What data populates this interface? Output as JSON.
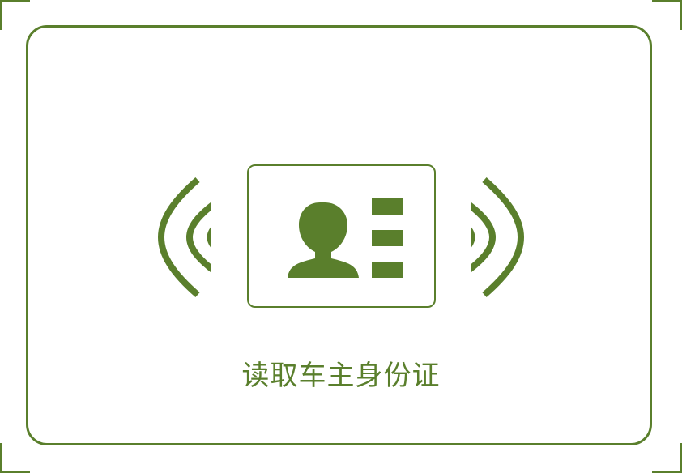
{
  "colors": {
    "accent": "#5a7f2c",
    "background": "#ffffff"
  },
  "icons": {
    "card": "id-card-icon",
    "person": "person-icon",
    "wave_left": "nfc-wave-left-icon",
    "wave_right": "nfc-wave-right-icon"
  },
  "instruction": {
    "text": "读取车主身份证"
  }
}
